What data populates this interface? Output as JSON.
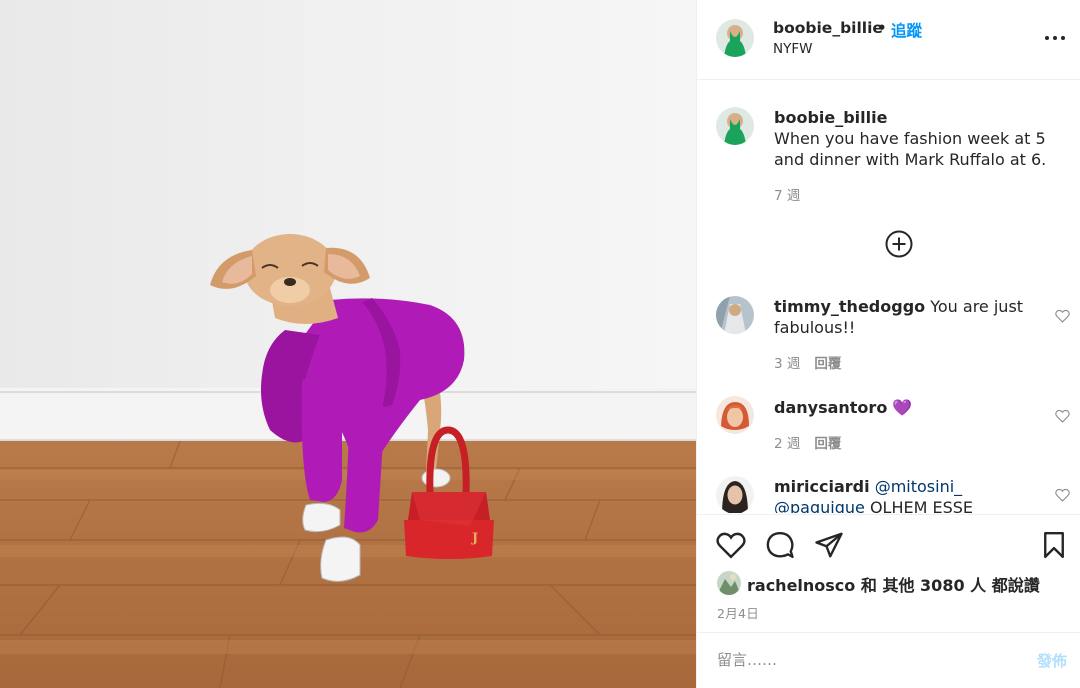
{
  "photo": {
    "alt_icon": "dog-photo"
  },
  "header": {
    "username": "boobie_billie",
    "separator": "•",
    "follow_label": "追蹤",
    "location": "NYFW",
    "more_icon": "more-horizontal-icon"
  },
  "caption": {
    "username": "boobie_billie",
    "text": "When you have fashion week at 5 and dinner with Mark Ruffalo at 6.",
    "time": "7 週"
  },
  "load_more_icon": "plus-circle-icon",
  "comments": [
    {
      "username": "timmy_thedoggo",
      "text": "You are just fabulous!!",
      "time": "3 週",
      "reply_label": "回覆"
    },
    {
      "username": "danysantoro",
      "text": "💜",
      "time": "2 週",
      "reply_label": "回覆"
    },
    {
      "username": "miricciardi",
      "mention1": "@mitosini_",
      "mention2": "@paquique",
      "text": "OLHEM ESSE INSTAGRAAAAMMM"
    }
  ],
  "actions": {
    "like_icon": "heart-icon",
    "comment_icon": "comment-icon",
    "share_icon": "send-icon",
    "save_icon": "bookmark-icon"
  },
  "likes": {
    "username": "rachelnosco",
    "and": "和",
    "others_label": "其他",
    "count": "3080",
    "people_label": "人",
    "suffix": "都說讚"
  },
  "post_date": "2月4日",
  "add_comment": {
    "placeholder": "留言……",
    "post_label": "發佈"
  },
  "colors": {
    "accent": "#0095f6",
    "post_disabled": "#b2dffc",
    "muted": "#8e8e8e",
    "text": "#262626",
    "outfit": "#b01bb8",
    "bag": "#d8262b"
  }
}
